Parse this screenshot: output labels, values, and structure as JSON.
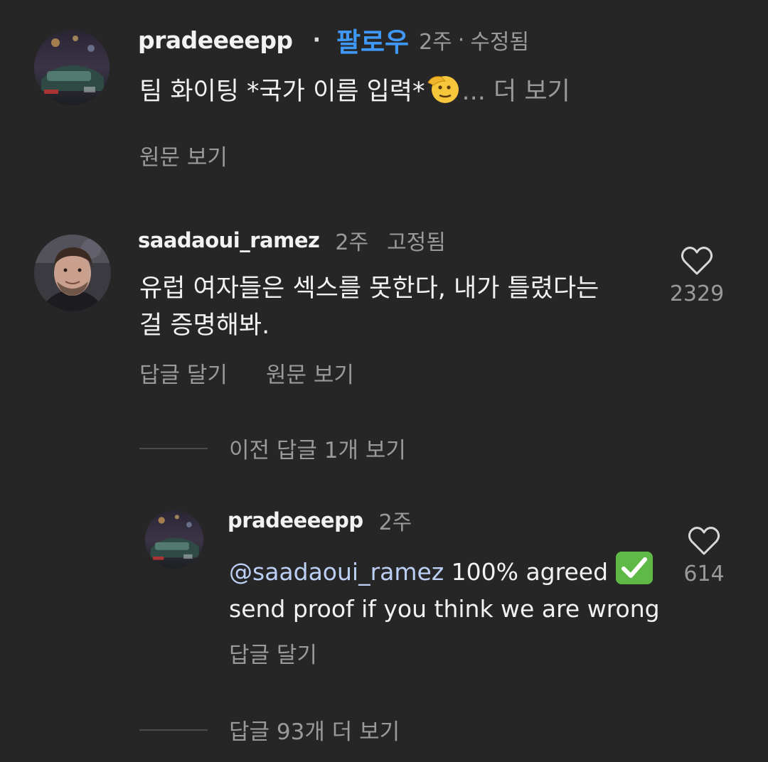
{
  "comments": [
    {
      "username": "pradeeeepp",
      "separator": "·",
      "follow_label": "팔로우",
      "time": "2주",
      "meta_sep": "·",
      "edited": "수정됨",
      "text": "팀 화이팅 *국가 이름 입력*",
      "emoji": "saluting-face",
      "more": "... 더 보기",
      "translate_label": "원문 보기"
    },
    {
      "username": "saadaoui_ramez",
      "time": "2주",
      "pinned": "고정됨",
      "text_line1": "유럽 여자들은 섹스를 못한다, 내가 틀렸다는",
      "text_line2": "걸 증명해봐.",
      "like_count": "2329",
      "reply_label": "답글 달기",
      "translate_label": "원문 보기",
      "view_prev_replies": "이전 답글 1개 보기",
      "replies": [
        {
          "username": "pradeeeepp",
          "time": "2주",
          "mention": "@saadaoui_ramez",
          "text_line1": " 100% agreed",
          "emoji": "check-mark-button",
          "text_line2": "send proof if you think we are wrong",
          "like_count": "614",
          "reply_label": "답글 달기"
        }
      ],
      "view_more_replies": "답글 93개 더 보기"
    }
  ],
  "colors": {
    "background": "#262626",
    "text": "#f2f2f2",
    "muted": "#9a9a9a",
    "follow": "#3f97f6",
    "mention": "#bcd0f5",
    "check_green": "#5fb946"
  }
}
